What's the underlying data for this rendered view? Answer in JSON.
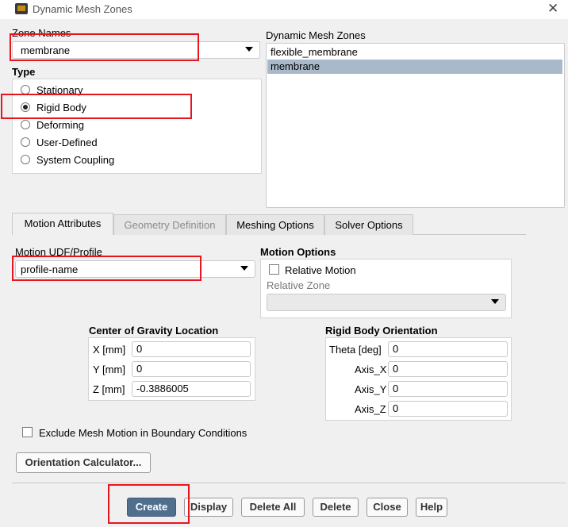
{
  "window": {
    "title": "Dynamic Mesh Zones",
    "close_glyph": "✕"
  },
  "zone_names": {
    "label": "Zone Names",
    "value": "membrane"
  },
  "type_group": {
    "label": "Type",
    "options": [
      "Stationary",
      "Rigid Body",
      "Deforming",
      "User-Defined",
      "System Coupling"
    ],
    "selected": "Rigid Body"
  },
  "dynamic_mesh_zones": {
    "label": "Dynamic Mesh Zones",
    "items": [
      "flexible_membrane",
      "membrane"
    ],
    "selected": "membrane"
  },
  "tabs": [
    "Motion Attributes",
    "Geometry Definition",
    "Meshing Options",
    "Solver Options"
  ],
  "active_tab": "Motion Attributes",
  "motion_udf": {
    "label": "Motion UDF/Profile",
    "value": "profile-name"
  },
  "motion_options": {
    "label": "Motion Options",
    "relative_motion_label": "Relative Motion",
    "relative_motion_checked": false,
    "relative_zone_label": "Relative Zone",
    "relative_zone_value": ""
  },
  "cog": {
    "label": "Center of Gravity Location",
    "x_label": "X [mm]",
    "x_value": "0",
    "y_label": "Y [mm]",
    "y_value": "0",
    "z_label": "Z [mm]",
    "z_value": "-0.3886005"
  },
  "orientation": {
    "label": "Rigid Body Orientation",
    "theta_label": "Theta [deg]",
    "theta_value": "0",
    "axis_x_label": "Axis_X",
    "axis_x_value": "0",
    "axis_y_label": "Axis_Y",
    "axis_y_value": "0",
    "axis_z_label": "Axis_Z",
    "axis_z_value": "0"
  },
  "exclude_mesh_motion": {
    "label": "Exclude Mesh Motion in Boundary Conditions",
    "checked": false
  },
  "orientation_calc_label": "Orientation Calculator...",
  "buttons": {
    "create": "Create",
    "display": "Display",
    "delete_all": "Delete All",
    "delete": "Delete",
    "close": "Close",
    "help": "Help"
  },
  "colors": {
    "highlight": "#e8141e",
    "selection": "#a9b9ca",
    "primary_button": "#4f6f8d"
  }
}
